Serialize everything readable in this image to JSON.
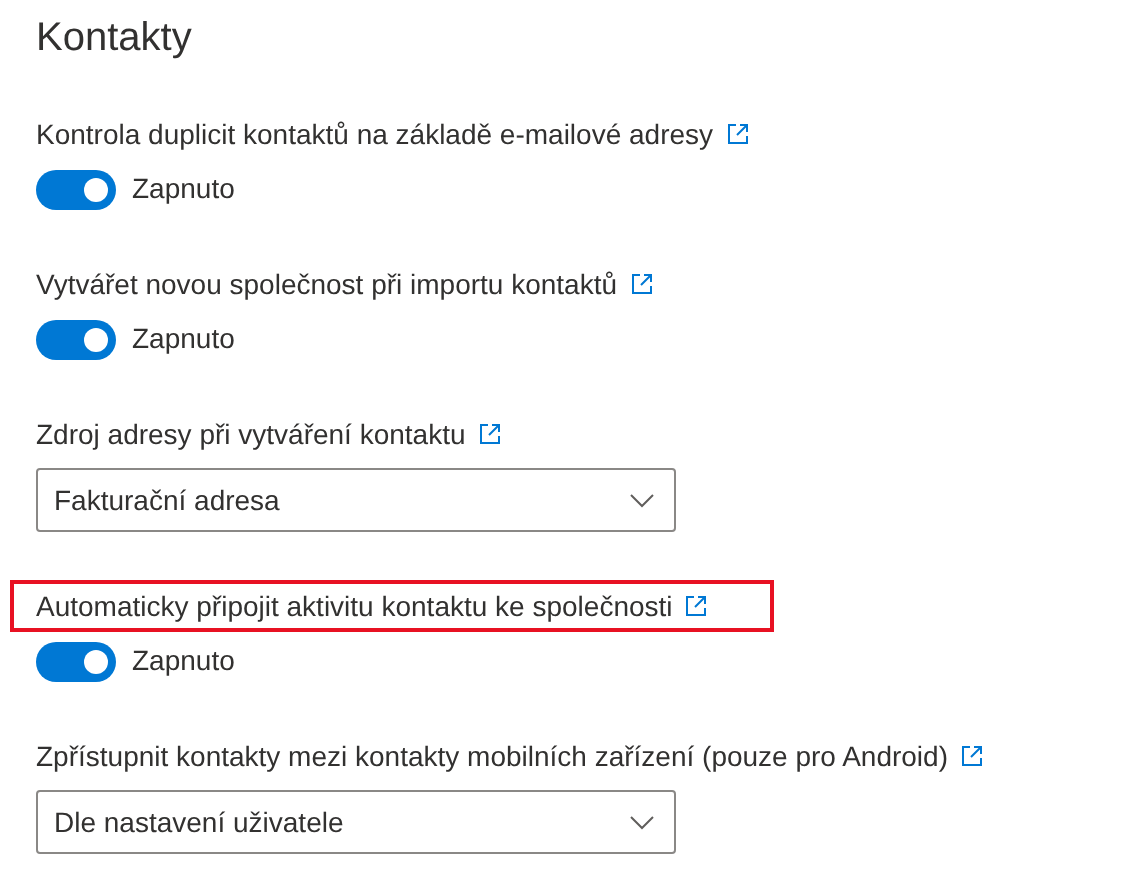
{
  "title": "Kontakty",
  "settings": [
    {
      "kind": "toggle",
      "label": "Kontrola duplicit kontaktů na základě e-mailové adresy",
      "highlighted": false,
      "on": true,
      "state_text": "Zapnuto"
    },
    {
      "kind": "toggle",
      "label": "Vytvářet novou společnost při importu kontaktů",
      "highlighted": false,
      "on": true,
      "state_text": "Zapnuto"
    },
    {
      "kind": "dropdown",
      "label": "Zdroj adresy při vytváření kontaktu",
      "highlighted": false,
      "value": "Fakturační adresa"
    },
    {
      "kind": "toggle",
      "label": "Automaticky připojit aktivitu kontaktu ke společnosti",
      "highlighted": true,
      "on": true,
      "state_text": "Zapnuto"
    },
    {
      "kind": "dropdown",
      "label": "Zpřístupnit kontakty mezi kontakty mobilních zařízení (pouze pro Android)",
      "highlighted": false,
      "value": "Dle nastavení uživatele"
    }
  ]
}
